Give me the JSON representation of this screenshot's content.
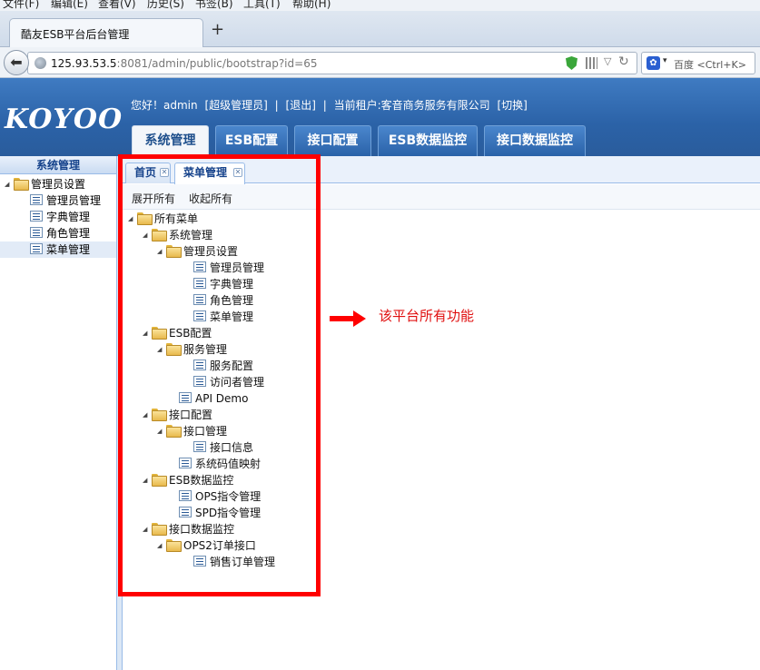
{
  "browser": {
    "menu": [
      "文件(F)",
      "编辑(E)",
      "查看(V)",
      "历史(S)",
      "书签(B)",
      "工具(T)",
      "帮助(H)"
    ],
    "tab_title": "酷友ESB平台后台管理",
    "new_tab": "+",
    "url_host": "125.93.53.5",
    "url_rest": ":8081/admin/public/bootstrap?id=65",
    "search_engine": "百度",
    "search_placeholder": "<Ctrl+K>"
  },
  "header": {
    "logo": "KOYOO",
    "greeting": "您好！admin",
    "role": "[超级管理员]",
    "logout": "[退出]",
    "tenant": "当前租户:客音商务服务有限公司",
    "switch": "[切换]",
    "nav": [
      {
        "label": "系统管理",
        "active": true
      },
      {
        "label": "ESB配置",
        "active": false
      },
      {
        "label": "接口配置",
        "active": false
      },
      {
        "label": "ESB数据监控",
        "active": false
      },
      {
        "label": "接口数据监控",
        "active": false
      }
    ]
  },
  "left_panel": {
    "title": "系统管理",
    "tree": [
      {
        "label": "管理员设置",
        "type": "folder",
        "level": 0
      },
      {
        "label": "管理员管理",
        "type": "file",
        "level": 1
      },
      {
        "label": "字典管理",
        "type": "file",
        "level": 1
      },
      {
        "label": "角色管理",
        "type": "file",
        "level": 1
      },
      {
        "label": "菜单管理",
        "type": "file",
        "level": 1,
        "selected": true
      }
    ]
  },
  "content": {
    "tabs": [
      {
        "label": "首页",
        "active": false
      },
      {
        "label": "菜单管理",
        "active": true
      }
    ],
    "toolbar": {
      "expand_all": "展开所有",
      "collapse_all": "收起所有"
    },
    "tree": [
      {
        "label": "所有菜单",
        "type": "folder",
        "level": 0
      },
      {
        "label": "系统管理",
        "type": "folder",
        "level": 1
      },
      {
        "label": "管理员设置",
        "type": "folder",
        "level": 2
      },
      {
        "label": "管理员管理",
        "type": "file",
        "level": 3
      },
      {
        "label": "字典管理",
        "type": "file",
        "level": 3
      },
      {
        "label": "角色管理",
        "type": "file",
        "level": 3
      },
      {
        "label": "菜单管理",
        "type": "file",
        "level": 3
      },
      {
        "label": "ESB配置",
        "type": "folder",
        "level": 1
      },
      {
        "label": "服务管理",
        "type": "folder",
        "level": 2
      },
      {
        "label": "服务配置",
        "type": "file",
        "level": 3
      },
      {
        "label": "访问者管理",
        "type": "file",
        "level": 3
      },
      {
        "label": "API Demo",
        "type": "file",
        "level": 2
      },
      {
        "label": "接口配置",
        "type": "folder",
        "level": 1
      },
      {
        "label": "接口管理",
        "type": "folder",
        "level": 2
      },
      {
        "label": "接口信息",
        "type": "file",
        "level": 3
      },
      {
        "label": "系统码值映射",
        "type": "file",
        "level": 2
      },
      {
        "label": "ESB数据监控",
        "type": "folder",
        "level": 1
      },
      {
        "label": "OPS指令管理",
        "type": "file",
        "level": 2
      },
      {
        "label": "SPD指令管理",
        "type": "file",
        "level": 2
      },
      {
        "label": "接口数据监控",
        "type": "folder",
        "level": 1
      },
      {
        "label": "OPS2订单接口",
        "type": "folder",
        "level": 2
      },
      {
        "label": "销售订单管理",
        "type": "file",
        "level": 3
      }
    ]
  },
  "annotation": {
    "text": "该平台所有功能",
    "color": "#ff0000"
  }
}
